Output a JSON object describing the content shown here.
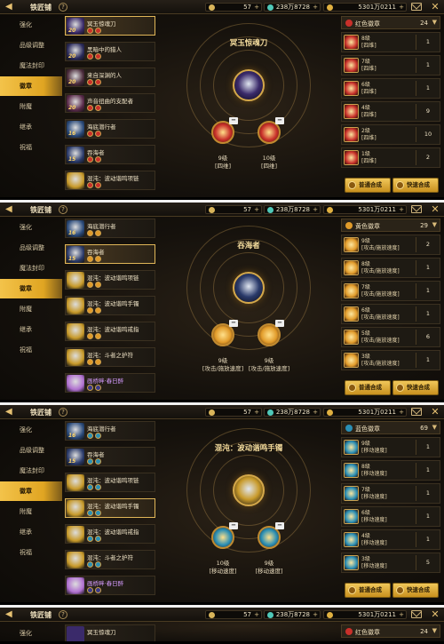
{
  "topbar": {
    "title": "铁匠铺",
    "gold": "57",
    "gems": "238万8728",
    "coins": "5301万0211"
  },
  "sidenav": [
    "强化",
    "品级调整",
    "魔法封印",
    "徽章",
    "附魔",
    "继承",
    "祝福"
  ],
  "panels": [
    {
      "items": [
        {
          "name": "冥玉惊魂刀",
          "lvl": "20",
          "sel": true,
          "color": "#3a2a6a"
        },
        {
          "name": "黑暗中的猎人",
          "lvl": "20",
          "color": "#2a2a5a"
        },
        {
          "name": "来自深渊的人",
          "lvl": "20",
          "color": "#4a2a3a"
        },
        {
          "name": "声音扭曲的支配者",
          "lvl": "20",
          "color": "#5a2a4a"
        },
        {
          "name": "海底潜行者",
          "lvl": "16",
          "color": "#2a4a7a"
        },
        {
          "name": "吞海者",
          "lvl": "15",
          "color": "#2a3a6a"
        },
        {
          "name": "混沌：波动谐鸣项链",
          "lvl": "",
          "color": "#c89a2a"
        }
      ],
      "center_title": "冥玉惊魂刀",
      "slots": [
        {
          "level": "9级",
          "stat": "[四维]"
        },
        {
          "level": "10级",
          "stat": "[四维]"
        }
      ],
      "right": {
        "header": "红色徽章",
        "count": "24",
        "rows": [
          {
            "label": "8级",
            "stat": "[四维]",
            "qty": "1"
          },
          {
            "label": "7级",
            "stat": "[四维]",
            "qty": "1"
          },
          {
            "label": "6级",
            "stat": "[四维]",
            "qty": "1"
          },
          {
            "label": "4级",
            "stat": "[四维]",
            "qty": "9"
          },
          {
            "label": "2级",
            "stat": "[四维]",
            "qty": "10"
          },
          {
            "label": "1级",
            "stat": "[四维]",
            "qty": "2"
          }
        ]
      }
    },
    {
      "items": [
        {
          "name": "海底潜行者",
          "lvl": "16",
          "color": "#2a4a7a"
        },
        {
          "name": "吞海者",
          "lvl": "15",
          "sel": true,
          "color": "#2a3a6a"
        },
        {
          "name": "混沌：波动谐鸣项链",
          "lvl": "",
          "color": "#c89a2a"
        },
        {
          "name": "混沌：波动谐鸣手镯",
          "lvl": "",
          "color": "#c89a2a"
        },
        {
          "name": "混沌：波动谐鸣戒指",
          "lvl": "",
          "color": "#c89a2a"
        },
        {
          "name": "混沌：斗者之护符",
          "lvl": "",
          "color": "#c89a2a"
        },
        {
          "name": "画桥畔·春日醉",
          "lvl": "",
          "purple": true,
          "color": "#b070d0"
        }
      ],
      "center_title": "吞海者",
      "slots": [
        {
          "level": "9级",
          "stat": "[攻击/施放速度]"
        },
        {
          "level": "9级",
          "stat": "[攻击/施放速度]"
        }
      ],
      "right": {
        "header": "黄色徽章",
        "count": "29",
        "rows": [
          {
            "label": "9级",
            "stat": "[攻击/施放速度]",
            "qty": "2"
          },
          {
            "label": "8级",
            "stat": "[攻击/施放速度]",
            "qty": "1"
          },
          {
            "label": "7级",
            "stat": "[攻击/施放速度]",
            "qty": "1"
          },
          {
            "label": "6级",
            "stat": "[攻击/施放速度]",
            "qty": "1"
          },
          {
            "label": "5级",
            "stat": "[攻击/施放速度]",
            "qty": "6"
          },
          {
            "label": "3级",
            "stat": "[攻击/施放速度]",
            "qty": "1"
          }
        ]
      }
    },
    {
      "items": [
        {
          "name": "海底潜行者",
          "lvl": "16",
          "color": "#2a4a7a"
        },
        {
          "name": "吞海者",
          "lvl": "15",
          "color": "#2a3a6a"
        },
        {
          "name": "混沌：波动谐鸣项链",
          "lvl": "",
          "color": "#c89a2a"
        },
        {
          "name": "混沌：波动谐鸣手镯",
          "lvl": "",
          "sel": true,
          "color": "#c89a2a"
        },
        {
          "name": "混沌：波动谐鸣戒指",
          "lvl": "",
          "color": "#c89a2a"
        },
        {
          "name": "混沌：斗者之护符",
          "lvl": "",
          "color": "#c89a2a"
        },
        {
          "name": "画桥畔·春日醉",
          "lvl": "",
          "purple": true,
          "color": "#b070d0"
        }
      ],
      "center_title": "混沌：波动谐鸣手镯",
      "slots": [
        {
          "level": "10级",
          "stat": "[移动速度]"
        },
        {
          "level": "9级",
          "stat": "[移动速度]"
        }
      ],
      "right": {
        "header": "蓝色徽章",
        "count": "69",
        "rows": [
          {
            "label": "9级",
            "stat": "[移动速度]",
            "qty": "1"
          },
          {
            "label": "8级",
            "stat": "[移动速度]",
            "qty": "1"
          },
          {
            "label": "7级",
            "stat": "[移动速度]",
            "qty": "1"
          },
          {
            "label": "6级",
            "stat": "[移动速度]",
            "qty": "1"
          },
          {
            "label": "4级",
            "stat": "[移动速度]",
            "qty": "1"
          },
          {
            "label": "3级",
            "stat": "[移动速度]",
            "qty": "5"
          }
        ]
      }
    },
    {
      "items": [
        {
          "name": "冥玉惊魂刀",
          "lvl": "",
          "color": "#3a2a6a"
        }
      ],
      "center_title": "",
      "slots": [],
      "right": {
        "header": "红色徽章",
        "count": "24",
        "rows": []
      }
    }
  ],
  "buttons": {
    "normal": "普通合成",
    "fast": "快速合成"
  },
  "colors": {
    "red": "#c9302a",
    "yellow": "#e19b2a",
    "blue": "#2a8fb5",
    "gold_accent": "#e0b658"
  },
  "icons": {
    "back": "back-arrow-icon",
    "help": "question-icon",
    "mail": "mail-icon",
    "close": "close-icon"
  }
}
